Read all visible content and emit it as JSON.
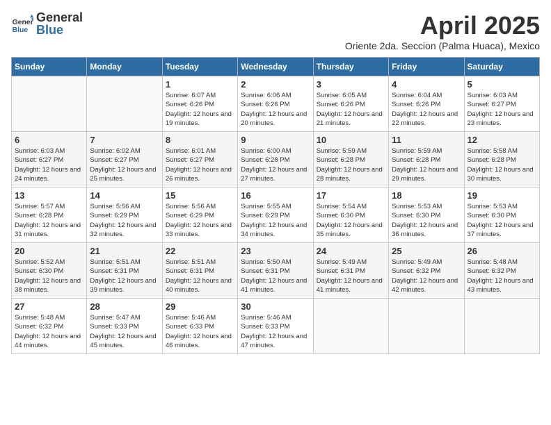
{
  "header": {
    "logo_general": "General",
    "logo_blue": "Blue",
    "month_title": "April 2025",
    "subtitle": "Oriente 2da. Seccion (Palma Huaca), Mexico"
  },
  "days_of_week": [
    "Sunday",
    "Monday",
    "Tuesday",
    "Wednesday",
    "Thursday",
    "Friday",
    "Saturday"
  ],
  "weeks": [
    [
      {
        "day": "",
        "sunrise": "",
        "sunset": "",
        "daylight": "",
        "empty": true
      },
      {
        "day": "",
        "sunrise": "",
        "sunset": "",
        "daylight": "",
        "empty": true
      },
      {
        "day": "1",
        "sunrise": "Sunrise: 6:07 AM",
        "sunset": "Sunset: 6:26 PM",
        "daylight": "Daylight: 12 hours and 19 minutes."
      },
      {
        "day": "2",
        "sunrise": "Sunrise: 6:06 AM",
        "sunset": "Sunset: 6:26 PM",
        "daylight": "Daylight: 12 hours and 20 minutes."
      },
      {
        "day": "3",
        "sunrise": "Sunrise: 6:05 AM",
        "sunset": "Sunset: 6:26 PM",
        "daylight": "Daylight: 12 hours and 21 minutes."
      },
      {
        "day": "4",
        "sunrise": "Sunrise: 6:04 AM",
        "sunset": "Sunset: 6:26 PM",
        "daylight": "Daylight: 12 hours and 22 minutes."
      },
      {
        "day": "5",
        "sunrise": "Sunrise: 6:03 AM",
        "sunset": "Sunset: 6:27 PM",
        "daylight": "Daylight: 12 hours and 23 minutes."
      }
    ],
    [
      {
        "day": "6",
        "sunrise": "Sunrise: 6:03 AM",
        "sunset": "Sunset: 6:27 PM",
        "daylight": "Daylight: 12 hours and 24 minutes."
      },
      {
        "day": "7",
        "sunrise": "Sunrise: 6:02 AM",
        "sunset": "Sunset: 6:27 PM",
        "daylight": "Daylight: 12 hours and 25 minutes."
      },
      {
        "day": "8",
        "sunrise": "Sunrise: 6:01 AM",
        "sunset": "Sunset: 6:27 PM",
        "daylight": "Daylight: 12 hours and 26 minutes."
      },
      {
        "day": "9",
        "sunrise": "Sunrise: 6:00 AM",
        "sunset": "Sunset: 6:28 PM",
        "daylight": "Daylight: 12 hours and 27 minutes."
      },
      {
        "day": "10",
        "sunrise": "Sunrise: 5:59 AM",
        "sunset": "Sunset: 6:28 PM",
        "daylight": "Daylight: 12 hours and 28 minutes."
      },
      {
        "day": "11",
        "sunrise": "Sunrise: 5:59 AM",
        "sunset": "Sunset: 6:28 PM",
        "daylight": "Daylight: 12 hours and 29 minutes."
      },
      {
        "day": "12",
        "sunrise": "Sunrise: 5:58 AM",
        "sunset": "Sunset: 6:28 PM",
        "daylight": "Daylight: 12 hours and 30 minutes."
      }
    ],
    [
      {
        "day": "13",
        "sunrise": "Sunrise: 5:57 AM",
        "sunset": "Sunset: 6:28 PM",
        "daylight": "Daylight: 12 hours and 31 minutes."
      },
      {
        "day": "14",
        "sunrise": "Sunrise: 5:56 AM",
        "sunset": "Sunset: 6:29 PM",
        "daylight": "Daylight: 12 hours and 32 minutes."
      },
      {
        "day": "15",
        "sunrise": "Sunrise: 5:56 AM",
        "sunset": "Sunset: 6:29 PM",
        "daylight": "Daylight: 12 hours and 33 minutes."
      },
      {
        "day": "16",
        "sunrise": "Sunrise: 5:55 AM",
        "sunset": "Sunset: 6:29 PM",
        "daylight": "Daylight: 12 hours and 34 minutes."
      },
      {
        "day": "17",
        "sunrise": "Sunrise: 5:54 AM",
        "sunset": "Sunset: 6:30 PM",
        "daylight": "Daylight: 12 hours and 35 minutes."
      },
      {
        "day": "18",
        "sunrise": "Sunrise: 5:53 AM",
        "sunset": "Sunset: 6:30 PM",
        "daylight": "Daylight: 12 hours and 36 minutes."
      },
      {
        "day": "19",
        "sunrise": "Sunrise: 5:53 AM",
        "sunset": "Sunset: 6:30 PM",
        "daylight": "Daylight: 12 hours and 37 minutes."
      }
    ],
    [
      {
        "day": "20",
        "sunrise": "Sunrise: 5:52 AM",
        "sunset": "Sunset: 6:30 PM",
        "daylight": "Daylight: 12 hours and 38 minutes."
      },
      {
        "day": "21",
        "sunrise": "Sunrise: 5:51 AM",
        "sunset": "Sunset: 6:31 PM",
        "daylight": "Daylight: 12 hours and 39 minutes."
      },
      {
        "day": "22",
        "sunrise": "Sunrise: 5:51 AM",
        "sunset": "Sunset: 6:31 PM",
        "daylight": "Daylight: 12 hours and 40 minutes."
      },
      {
        "day": "23",
        "sunrise": "Sunrise: 5:50 AM",
        "sunset": "Sunset: 6:31 PM",
        "daylight": "Daylight: 12 hours and 41 minutes."
      },
      {
        "day": "24",
        "sunrise": "Sunrise: 5:49 AM",
        "sunset": "Sunset: 6:31 PM",
        "daylight": "Daylight: 12 hours and 41 minutes."
      },
      {
        "day": "25",
        "sunrise": "Sunrise: 5:49 AM",
        "sunset": "Sunset: 6:32 PM",
        "daylight": "Daylight: 12 hours and 42 minutes."
      },
      {
        "day": "26",
        "sunrise": "Sunrise: 5:48 AM",
        "sunset": "Sunset: 6:32 PM",
        "daylight": "Daylight: 12 hours and 43 minutes."
      }
    ],
    [
      {
        "day": "27",
        "sunrise": "Sunrise: 5:48 AM",
        "sunset": "Sunset: 6:32 PM",
        "daylight": "Daylight: 12 hours and 44 minutes."
      },
      {
        "day": "28",
        "sunrise": "Sunrise: 5:47 AM",
        "sunset": "Sunset: 6:33 PM",
        "daylight": "Daylight: 12 hours and 45 minutes."
      },
      {
        "day": "29",
        "sunrise": "Sunrise: 5:46 AM",
        "sunset": "Sunset: 6:33 PM",
        "daylight": "Daylight: 12 hours and 46 minutes."
      },
      {
        "day": "30",
        "sunrise": "Sunrise: 5:46 AM",
        "sunset": "Sunset: 6:33 PM",
        "daylight": "Daylight: 12 hours and 47 minutes."
      },
      {
        "day": "",
        "sunrise": "",
        "sunset": "",
        "daylight": "",
        "empty": true
      },
      {
        "day": "",
        "sunrise": "",
        "sunset": "",
        "daylight": "",
        "empty": true
      },
      {
        "day": "",
        "sunrise": "",
        "sunset": "",
        "daylight": "",
        "empty": true
      }
    ]
  ]
}
